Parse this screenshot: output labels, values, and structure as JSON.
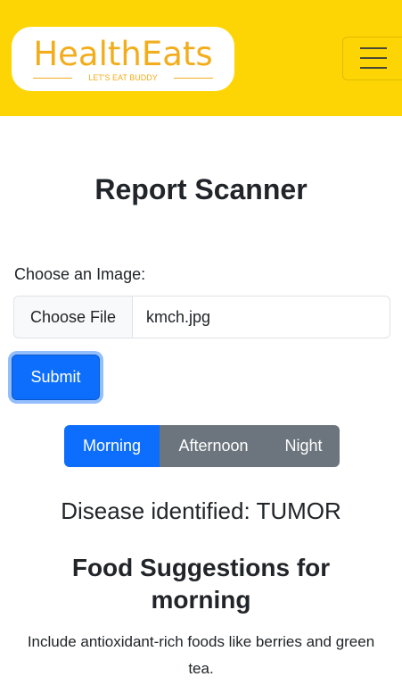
{
  "navbar": {
    "brand_name": "HealthEats",
    "brand_tagline": "LET'S EAT BUDDY",
    "colors": {
      "background": "#fdd504",
      "brand": "#f2ad1d"
    },
    "menu_icon": "hamburger-menu-icon"
  },
  "page": {
    "title": "Report Scanner"
  },
  "upload": {
    "label": "Choose an Image:",
    "choose_button": "Choose File",
    "file_name": "kmch.jpg",
    "submit_label": "Submit"
  },
  "time_tabs": {
    "items": [
      {
        "label": "Morning",
        "active": true
      },
      {
        "label": "Afternoon",
        "active": false
      },
      {
        "label": "Night",
        "active": false
      }
    ],
    "colors": {
      "active": "#0d6efd",
      "inactive": "#6c757d"
    }
  },
  "result": {
    "disease_text": "Disease identified: TUMOR",
    "food_title": "Food Suggestions for morning",
    "food_text": "Include antioxidant-rich foods like berries and green tea."
  }
}
